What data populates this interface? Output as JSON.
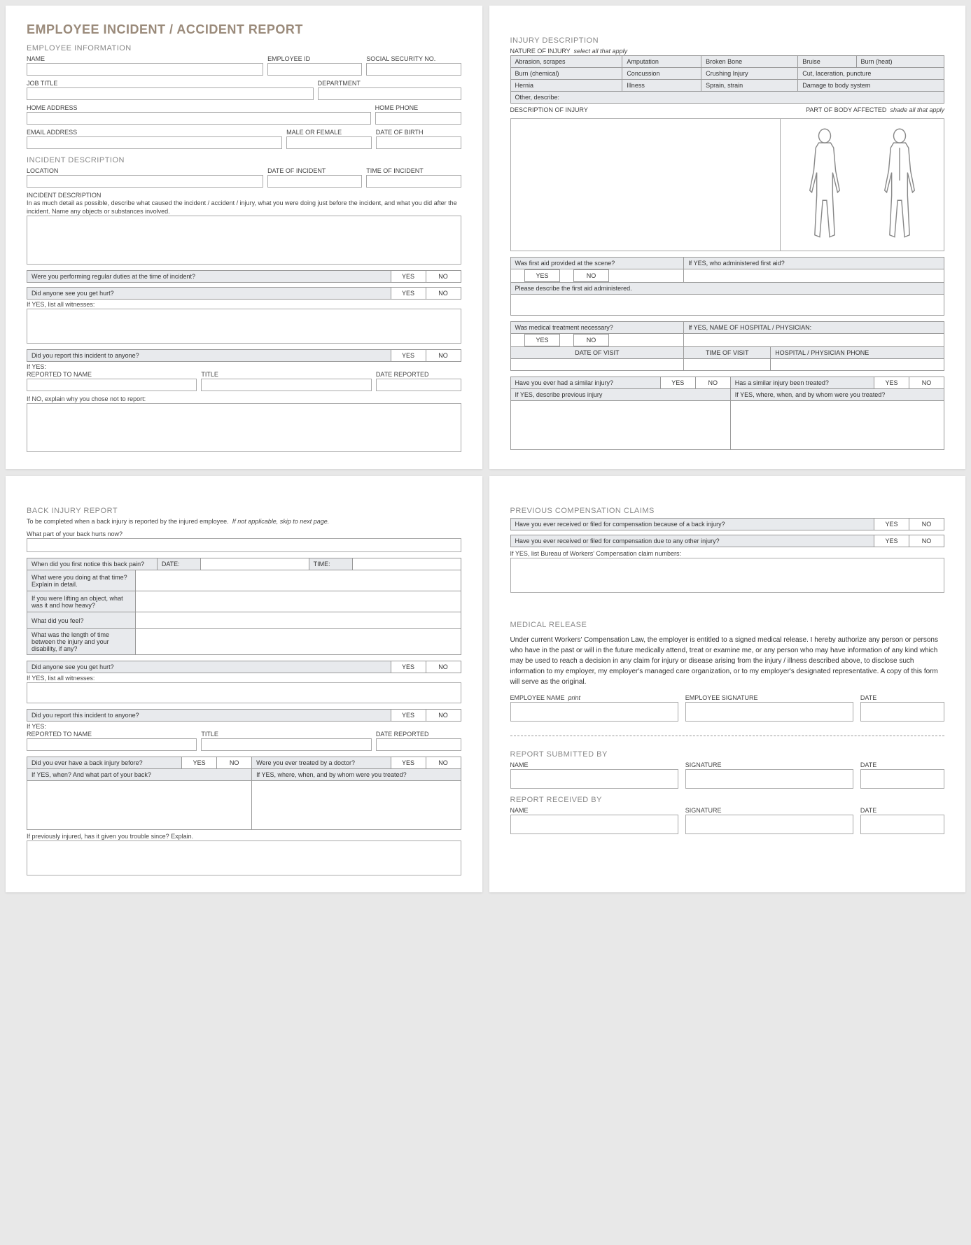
{
  "p1": {
    "title": "EMPLOYEE INCIDENT / ACCIDENT REPORT",
    "emp_info": "EMPLOYEE INFORMATION",
    "name": "NAME",
    "emp_id": "EMPLOYEE ID",
    "ssn": "SOCIAL SECURITY NO.",
    "job_title": "JOB TITLE",
    "department": "DEPARTMENT",
    "home_addr": "HOME ADDRESS",
    "home_phone": "HOME PHONE",
    "email": "EMAIL ADDRESS",
    "mf": "MALE OR FEMALE",
    "dob": "DATE OF BIRTH",
    "inc_desc": "INCIDENT DESCRIPTION",
    "location": "LOCATION",
    "date_inc": "DATE OF INCIDENT",
    "time_inc": "TIME OF INCIDENT",
    "inc_desc_lbl": "INCIDENT DESCRIPTION",
    "inc_desc_note": "In as much detail as possible, describe what caused the incident / accident / injury, what you were doing just before the incident, and what you did after the incident.  Name any objects or substances involved.",
    "q_duties": "Were you performing regular duties at the time of incident?",
    "q_witness": "Did anyone see you get hurt?",
    "q_witness_list": "If YES, list all witnesses:",
    "q_report": "Did you report this incident to anyone?",
    "if_yes": "If YES:",
    "reported_to": "REPORTED TO NAME",
    "title_lbl": "TITLE",
    "date_reported": "DATE REPORTED",
    "if_no_explain": "If NO, explain why you chose not to report:",
    "yes": "YES",
    "no": "NO"
  },
  "p2": {
    "injury_desc": "INJURY DESCRIPTION",
    "nature": "NATURE OF INJURY",
    "nature_note": "select all that apply",
    "cells": [
      "Abrasion, scrapes",
      "Amputation",
      "Broken Bone",
      "Bruise",
      "Burn (heat)",
      "Burn (chemical)",
      "Concussion",
      "Crushing Injury",
      "Cut, laceration, puncture",
      "Hernia",
      "Illness",
      "Sprain, strain",
      "Damage to body system",
      "Other, describe:"
    ],
    "desc_injury": "DESCRIPTION OF INJURY",
    "part_body": "PART OF BODY AFFECTED",
    "shade_note": "shade all that apply",
    "q_firstaid": "Was first aid provided at the scene?",
    "q_firstaid_who": "If YES, who administered first aid?",
    "q_firstaid_desc": "Please describe the first aid administered.",
    "q_medical": "Was medical treatment necessary?",
    "q_hospital": "If YES, NAME OF HOSPITAL / PHYSICIAN:",
    "date_visit": "DATE OF VISIT",
    "time_visit": "TIME OF VISIT",
    "hosp_phone": "HOSPITAL / PHYSICIAN PHONE",
    "q_similar": "Have you ever had a similar injury?",
    "q_treated": "Has a similar injury been treated?",
    "q_prev": "If YES, describe previous injury",
    "q_where": "If YES, where, when, and by whom were you treated?",
    "yes": "YES",
    "no": "NO"
  },
  "p3": {
    "back_report": "BACK INJURY REPORT",
    "back_note": "To be completed when a back injury is reported by the injured employee.",
    "back_skip": "If not applicable, skip to next page.",
    "q_part": "What part of your back hurts now?",
    "q_notice": "When did you first notice this back pain?",
    "date": "DATE:",
    "time": "TIME:",
    "q_doing": "What were you doing at that time?  Explain in detail.",
    "q_lifting": "If you were lifting an object, what was it and how heavy?",
    "q_feel": "What did you feel?",
    "q_length": "What was the length of time between the injury and your disability, if any?",
    "q_witness": "Did anyone see you get hurt?",
    "q_witness_list": "If YES, list all witnesses:",
    "q_report": "Did you report this incident to anyone?",
    "if_yes": "If YES:",
    "reported_to": "REPORTED TO NAME",
    "title_lbl": "TITLE",
    "date_reported": "DATE REPORTED",
    "q_prev_back": "Did you ever have a back injury before?",
    "q_doctor": "Were you ever treated by a doctor?",
    "q_when_part": "If YES, when? And what part of your back?",
    "q_where_treated": "If YES, where, when, and by whom were you treated?",
    "q_trouble": "If previously injured, has it given you trouble since?  Explain.",
    "yes": "YES",
    "no": "NO"
  },
  "p4": {
    "prev_comp": "PREVIOUS COMPENSATION CLAIMS",
    "q_comp_back": "Have you ever received or filed for compensation because of a back injury?",
    "q_comp_other": "Have you ever received or filed for compensation due to any other injury?",
    "q_bureau": "If YES, list Bureau of Workers' Compensation claim numbers:",
    "med_release": "MEDICAL RELEASE",
    "med_text": "Under current Workers' Compensation Law, the employer is entitled to a signed medical release.  I hereby authorize any person or persons who have in the past or will in the future medically attend, treat or examine me, or any person who may have information of any kind which may be used to reach a decision in any claim for injury or disease arising from the injury / illness described above, to disclose such information to my employer, my employer's managed care organization, or to my employer's designated representative.  A copy of this form will serve as the original.",
    "emp_name": "EMPLOYEE NAME",
    "print": "print",
    "emp_sig": "EMPLOYEE SIGNATURE",
    "date": "DATE",
    "submitted": "REPORT SUBMITTED BY",
    "received": "REPORT RECEIVED BY",
    "name": "NAME",
    "signature": "SIGNATURE",
    "yes": "YES",
    "no": "NO"
  }
}
